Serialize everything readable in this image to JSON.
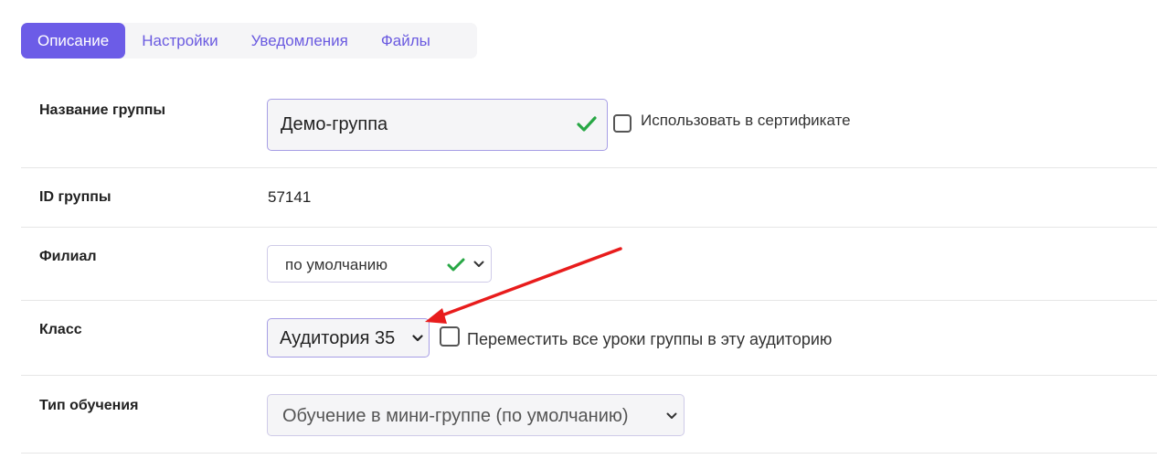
{
  "tabs": [
    {
      "label": "Описание",
      "active": true
    },
    {
      "label": "Настройки",
      "active": false
    },
    {
      "label": "Уведомления",
      "active": false
    },
    {
      "label": "Файлы",
      "active": false
    }
  ],
  "form": {
    "group_name": {
      "label": "Название группы",
      "value": "Демо-группа",
      "checkbox_label": "Использовать в сертификате",
      "checkbox_checked": false
    },
    "group_id": {
      "label": "ID группы",
      "value": "57141"
    },
    "branch": {
      "label": "Филиал",
      "selected": "по умолчанию"
    },
    "class": {
      "label": "Класс",
      "selected": "Аудитория 35",
      "checkbox_label": "Переместить все уроки группы в эту аудиторию",
      "checkbox_checked": false
    },
    "training_type": {
      "label": "Тип обучения",
      "selected": "Обучение в мини-группе (по умолчанию)"
    }
  },
  "colors": {
    "accent": "#6c5ce7",
    "valid_check": "#28a745",
    "annotation_arrow": "#e81c1c"
  }
}
